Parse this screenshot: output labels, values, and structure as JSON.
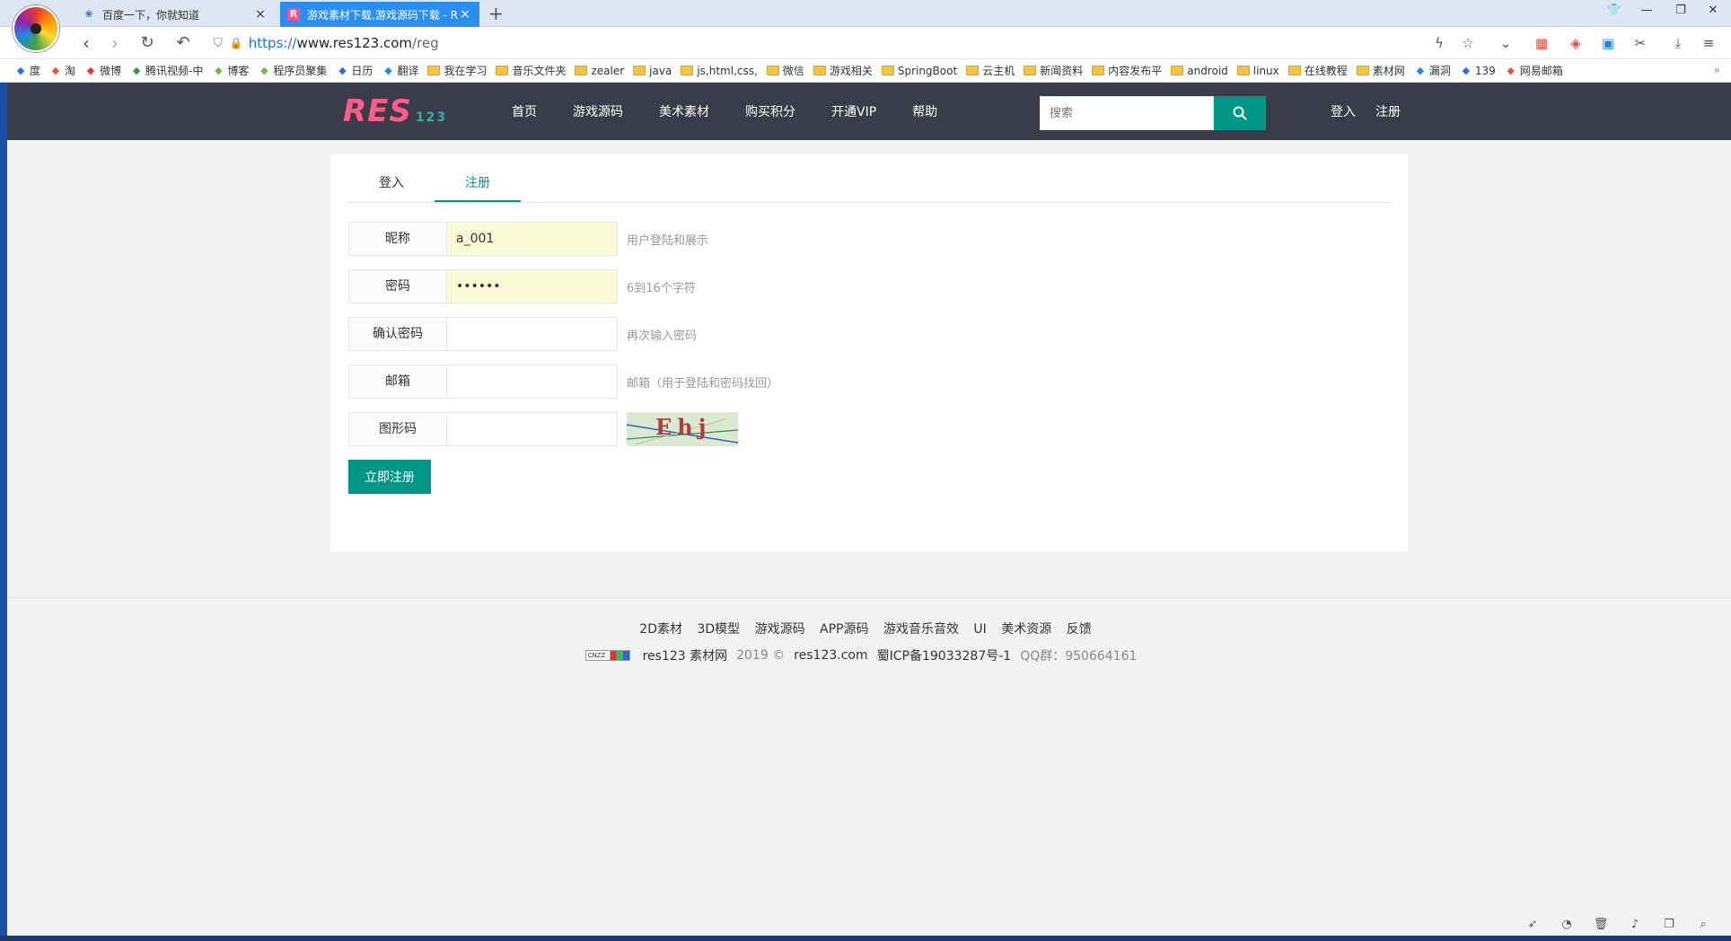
{
  "browser": {
    "tabs": [
      {
        "title": "百度一下，你就知道",
        "close": "×",
        "icon": "baidu-paw-icon"
      },
      {
        "title": "游戏素材下载,游戏源码下载 - R",
        "close": "×",
        "icon": "res-favicon-icon",
        "icon_glyph": "R"
      }
    ],
    "new_tab": "+",
    "address": {
      "scheme": "https://",
      "host": "www.res123.com",
      "path": "/reg"
    },
    "bookmarks": [
      {
        "label": "度",
        "type": "link"
      },
      {
        "label": "淘",
        "type": "link"
      },
      {
        "label": "微博",
        "type": "link"
      },
      {
        "label": "腾讯视频-中",
        "type": "link"
      },
      {
        "label": "博客",
        "type": "link"
      },
      {
        "label": "程序员聚集",
        "type": "link"
      },
      {
        "label": "日历",
        "type": "link"
      },
      {
        "label": "翻译",
        "type": "link"
      },
      {
        "label": "我在学习",
        "type": "folder"
      },
      {
        "label": "音乐文件夹",
        "type": "folder"
      },
      {
        "label": "zealer",
        "type": "folder"
      },
      {
        "label": "java",
        "type": "folder"
      },
      {
        "label": "js,html,css,",
        "type": "folder"
      },
      {
        "label": "微信",
        "type": "folder"
      },
      {
        "label": "游戏相关",
        "type": "folder"
      },
      {
        "label": "SpringBoot",
        "type": "folder"
      },
      {
        "label": "云主机",
        "type": "folder"
      },
      {
        "label": "新闻资料",
        "type": "folder"
      },
      {
        "label": "内容发布平",
        "type": "folder"
      },
      {
        "label": "android",
        "type": "folder"
      },
      {
        "label": "linux",
        "type": "folder"
      },
      {
        "label": "在线教程",
        "type": "folder"
      },
      {
        "label": "素材网",
        "type": "folder"
      },
      {
        "label": "漏洞",
        "type": "link"
      },
      {
        "label": "139",
        "type": "link"
      },
      {
        "label": "网易邮箱",
        "type": "link"
      }
    ],
    "bookmarks_more": "»"
  },
  "site": {
    "logo_big": "RES",
    "logo_small": "123",
    "nav": [
      "首页",
      "游戏源码",
      "美术素材",
      "购买积分",
      "开通VIP",
      "帮助"
    ],
    "search_placeholder": "搜索",
    "login": "登入",
    "register": "注册"
  },
  "form": {
    "tabs": [
      {
        "label": "登入",
        "active": false
      },
      {
        "label": "注册",
        "active": true
      }
    ],
    "fields": [
      {
        "label": "昵称",
        "value": "a_001",
        "hint": "用户登陆和展示",
        "type": "text"
      },
      {
        "label": "密码",
        "value": "••••••",
        "hint": "6到16个字符",
        "type": "password"
      },
      {
        "label": "确认密码",
        "value": "",
        "hint": "再次输入密码",
        "type": "password"
      },
      {
        "label": "邮箱",
        "value": "",
        "hint": "邮箱（用于登陆和密码找回）",
        "type": "text"
      },
      {
        "label": "图形码",
        "value": "",
        "hint": "",
        "type": "captcha"
      }
    ],
    "captcha_text": "Ehj",
    "submit": "立即注册"
  },
  "footer": {
    "links": [
      "2D素材",
      "3D模型",
      "游戏源码",
      "APP源码",
      "游戏音乐音效",
      "UI",
      "美术资源",
      "反馈"
    ],
    "cnzz": "CNZZ",
    "site_name": "res123 素材网",
    "year": "2019 ©",
    "domain": "res123.com",
    "icp": "蜀ICP备19033287号-1",
    "qq": "QQ群：950664161"
  },
  "colors": {
    "accent": "#009688",
    "header_bg": "#393d49",
    "logo_pink": "#ff5c8a",
    "tab_active_bg": "#2b8ef3"
  }
}
